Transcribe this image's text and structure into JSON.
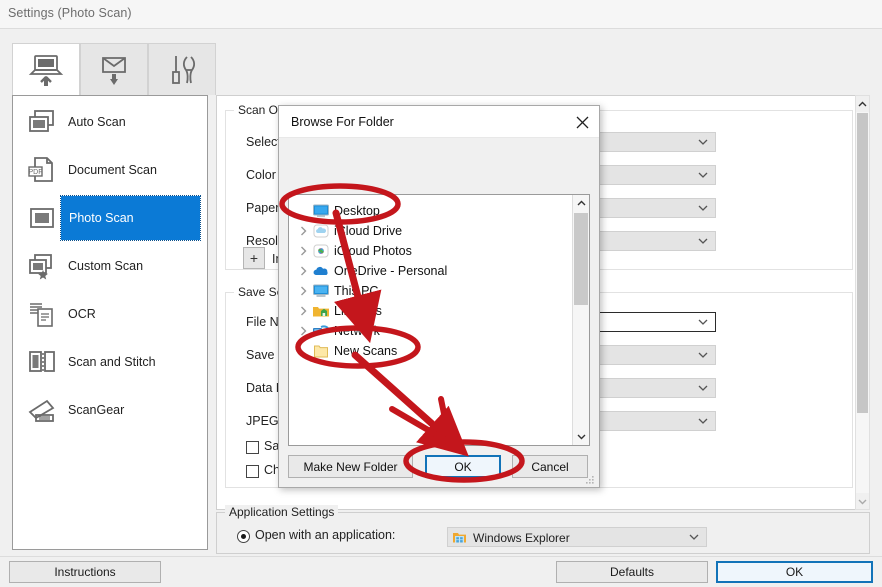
{
  "window": {
    "title": "Settings (Photo Scan)"
  },
  "tabs": [
    {
      "name": "scan-from-computer-tab",
      "icon": "computer-scan-icon",
      "active": true
    },
    {
      "name": "scan-from-scanner-tab",
      "icon": "scanner-save-icon",
      "active": false
    },
    {
      "name": "general-settings-tab",
      "icon": "tools-icon",
      "active": false
    }
  ],
  "sidebar": {
    "items": [
      {
        "label": "Auto Scan",
        "icon": "auto-scan-icon",
        "selected": false
      },
      {
        "label": "Document Scan",
        "icon": "pdf-document-icon",
        "selected": false
      },
      {
        "label": "Photo Scan",
        "icon": "photo-icon",
        "selected": true
      },
      {
        "label": "Custom Scan",
        "icon": "custom-star-icon",
        "selected": false
      },
      {
        "label": "OCR",
        "icon": "ocr-text-icon",
        "selected": false
      },
      {
        "label": "Scan and Stitch",
        "icon": "stitch-icon",
        "selected": false
      },
      {
        "label": "ScanGear",
        "icon": "scangear-icon",
        "selected": false
      }
    ]
  },
  "scan_options": {
    "group_label": "Scan Options",
    "rows": [
      {
        "label": "Select Source"
      },
      {
        "label": "Color Mode"
      },
      {
        "label": "Paper Size"
      },
      {
        "label": "Resolution"
      }
    ],
    "add_button": "+",
    "add_label": "Im"
  },
  "save_settings": {
    "group_label": "Save Settings",
    "rows": [
      {
        "label": "File Name"
      },
      {
        "label": "Save in"
      },
      {
        "label": "Data Format"
      },
      {
        "label": "JPEG Image Quality"
      }
    ],
    "checkboxes": [
      {
        "label": "Save",
        "checked": false
      },
      {
        "label": "Check",
        "checked": false
      }
    ]
  },
  "application_settings": {
    "group_label": "Application Settings",
    "radio_label": "Open with an application:",
    "radio_checked": true,
    "app_value": "Windows Explorer",
    "app_icon": "windows-explorer-icon"
  },
  "footer": {
    "instructions": "Instructions",
    "defaults": "Defaults",
    "ok": "OK"
  },
  "inner_defaults": {
    "label": "Defaults"
  },
  "dialog": {
    "title": "Browse For Folder",
    "close_icon": "close-icon",
    "prompt": "",
    "tree": [
      {
        "label": "Desktop",
        "icon": "desktop-icon",
        "chevron": false,
        "indent": 0
      },
      {
        "label": "iCloud Drive",
        "icon": "icloud-drive-icon",
        "chevron": true,
        "indent": 1
      },
      {
        "label": "iCloud Photos",
        "icon": "icloud-photos-icon",
        "chevron": true,
        "indent": 1
      },
      {
        "label": "OneDrive - Personal",
        "icon": "onedrive-icon",
        "chevron": true,
        "indent": 1
      },
      {
        "label": "This PC",
        "icon": "this-pc-icon",
        "chevron": true,
        "indent": 1
      },
      {
        "label": "Libraries",
        "icon": "libraries-icon",
        "chevron": true,
        "indent": 1
      },
      {
        "label": "Network",
        "icon": "network-icon",
        "chevron": true,
        "indent": 1
      },
      {
        "label": "New Scans",
        "icon": "folder-icon",
        "chevron": false,
        "indent": 1
      }
    ],
    "buttons": {
      "make_new_folder": "Make New Folder",
      "ok": "OK",
      "cancel": "Cancel"
    }
  },
  "annotations": {
    "color": "#c4161c",
    "shapes": [
      {
        "type": "ellipse",
        "target": "Desktop tree item"
      },
      {
        "type": "ellipse",
        "target": "New Scans tree item"
      },
      {
        "type": "ellipse",
        "target": "dialog OK button"
      },
      {
        "type": "arrow",
        "from": "Desktop",
        "to": "Network area"
      },
      {
        "type": "arrow",
        "from": "New Scans",
        "to": "OK button"
      }
    ]
  }
}
